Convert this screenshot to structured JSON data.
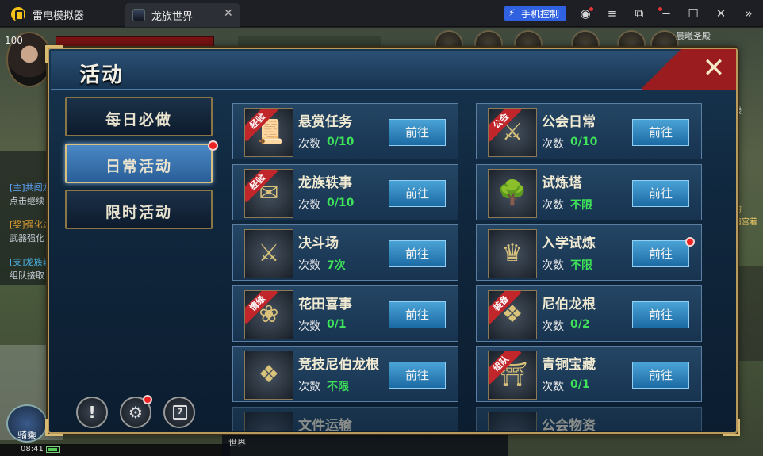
{
  "emulator": {
    "app_name": "雷电模拟器",
    "tab_title": "龙族世界",
    "tab_close": "✕",
    "phone_control": "手机控制"
  },
  "game_hud": {
    "level": "100",
    "zone_name": "晨曦圣殿",
    "line_label": "线",
    "chat": [
      {
        "text": "[主]共闯龙",
        "color": "blue"
      },
      {
        "text": "点击继续",
        "color": "white"
      },
      {
        "text": "[奖]强化达",
        "color": "orange"
      },
      {
        "text": "武器强化",
        "color": "white"
      },
      {
        "text": "[支]龙族轶",
        "color": "cyan"
      },
      {
        "text": "组队接取",
        "color": "white"
      }
    ],
    "ride_label": "骑乘",
    "time": "08:41",
    "world_label": "世界",
    "right_text1": "的",
    "right_text2": "暗宫着"
  },
  "panel": {
    "title": "活动",
    "categories": [
      {
        "label": "每日必做",
        "active": false,
        "has_dot": false
      },
      {
        "label": "日常活动",
        "active": true,
        "has_dot": true
      },
      {
        "label": "限时活动",
        "active": false,
        "has_dot": false
      }
    ],
    "footer_buttons": [
      {
        "name": "info-button",
        "icon": "exclamation-icon",
        "glyph": "!"
      },
      {
        "name": "settings-button",
        "icon": "gear-icon",
        "glyph": "⚙"
      },
      {
        "name": "calendar-button",
        "icon": "calendar-icon",
        "glyph": "7"
      }
    ],
    "count_label": "次数",
    "go_label": "前往",
    "activities": [
      {
        "name": "悬赏任务",
        "count": "0/10",
        "ribbon": "经验",
        "icon": "scroll-icon",
        "glyph": "📜",
        "dot": false
      },
      {
        "name": "公会日常",
        "count": "0/10",
        "ribbon": "公会",
        "icon": "shield-swords-icon",
        "glyph": "⚔",
        "dot": false
      },
      {
        "name": "龙族轶事",
        "count": "0/10",
        "ribbon": "经验",
        "icon": "letter-icon",
        "glyph": "✉",
        "dot": false
      },
      {
        "name": "试炼塔",
        "count": "不限",
        "ribbon": "",
        "icon": "tree-tower-icon",
        "glyph": "🌳",
        "dot": false
      },
      {
        "name": "决斗场",
        "count": "7次",
        "ribbon": "",
        "icon": "crossed-swords-icon",
        "glyph": "⚔",
        "dot": false
      },
      {
        "name": "入学试炼",
        "count": "不限",
        "ribbon": "",
        "icon": "gold-crest-icon",
        "glyph": "♛",
        "dot": true
      },
      {
        "name": "花田喜事",
        "count": "0/1",
        "ribbon": "情缘",
        "icon": "rose-bouquet-icon",
        "glyph": "❀",
        "dot": false
      },
      {
        "name": "尼伯龙根",
        "count": "0/2",
        "ribbon": "装备",
        "icon": "dragon-crest-icon",
        "glyph": "❖",
        "dot": false
      },
      {
        "name": "竞技尼伯龙根",
        "count": "不限",
        "ribbon": "",
        "icon": "dragon-crest-blue-icon",
        "glyph": "❖",
        "dot": false
      },
      {
        "name": "青铜宝藏",
        "count": "0/1",
        "ribbon": "组队",
        "icon": "bronze-gate-icon",
        "glyph": "⛩",
        "dot": false
      },
      {
        "name": "文件运输",
        "count": "",
        "ribbon": "",
        "icon": "transport-icon",
        "glyph": "",
        "dot": false
      },
      {
        "name": "公会物资",
        "count": "",
        "ribbon": "",
        "icon": "supplies-icon",
        "glyph": "",
        "dot": false
      }
    ]
  },
  "colors": {
    "accent_blue": "#2f61e0",
    "count_green": "#3fe35a",
    "ribbon_red": "#c0262a",
    "frame_gold": "#b89b5c"
  }
}
